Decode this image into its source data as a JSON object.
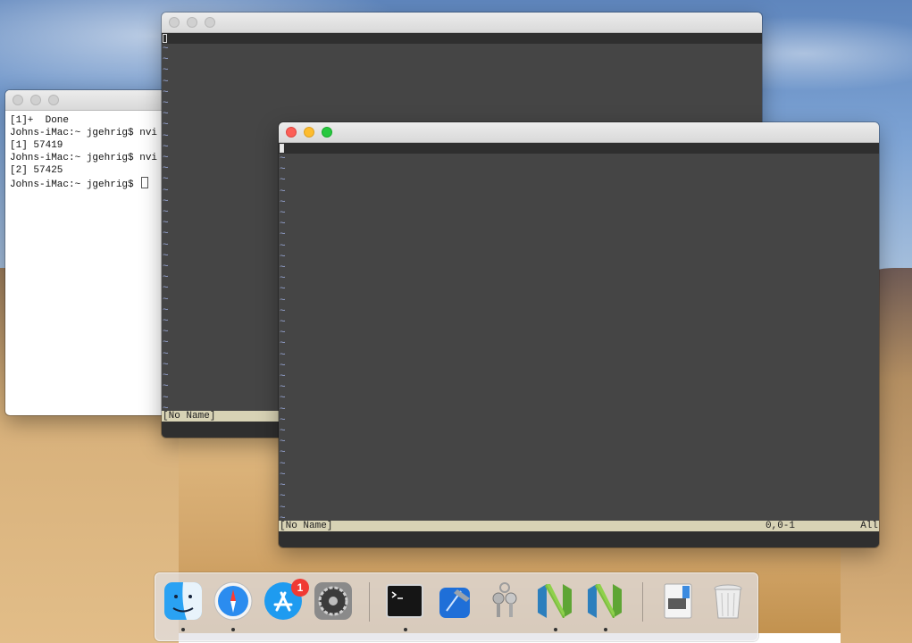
{
  "terminal": {
    "lines": [
      "[1]+  Done",
      "Johns-iMac:~ jgehrig$ nvi",
      "[1] 57419",
      "Johns-iMac:~ jgehrig$ nvi",
      "[2] 57425",
      "Johns-iMac:~ jgehrig$ "
    ]
  },
  "nvim_back": {
    "status_name": "[No Name]"
  },
  "nvim_front": {
    "status_name": "[No Name]",
    "cursor_position": "0,0-1",
    "scroll_position": "All"
  },
  "dock": {
    "items": [
      {
        "name": "finder",
        "running": true
      },
      {
        "name": "safari",
        "running": true
      },
      {
        "name": "app-store",
        "running": false,
        "badge": "1"
      },
      {
        "name": "system-preferences",
        "running": false
      },
      {
        "name": "terminal",
        "running": true
      },
      {
        "name": "xcode",
        "running": false
      },
      {
        "name": "keychain-access",
        "running": false
      },
      {
        "name": "neovim",
        "running": true
      },
      {
        "name": "neovim",
        "running": true
      },
      {
        "name": "preview",
        "running": false
      },
      {
        "name": "trash",
        "running": false
      }
    ]
  }
}
